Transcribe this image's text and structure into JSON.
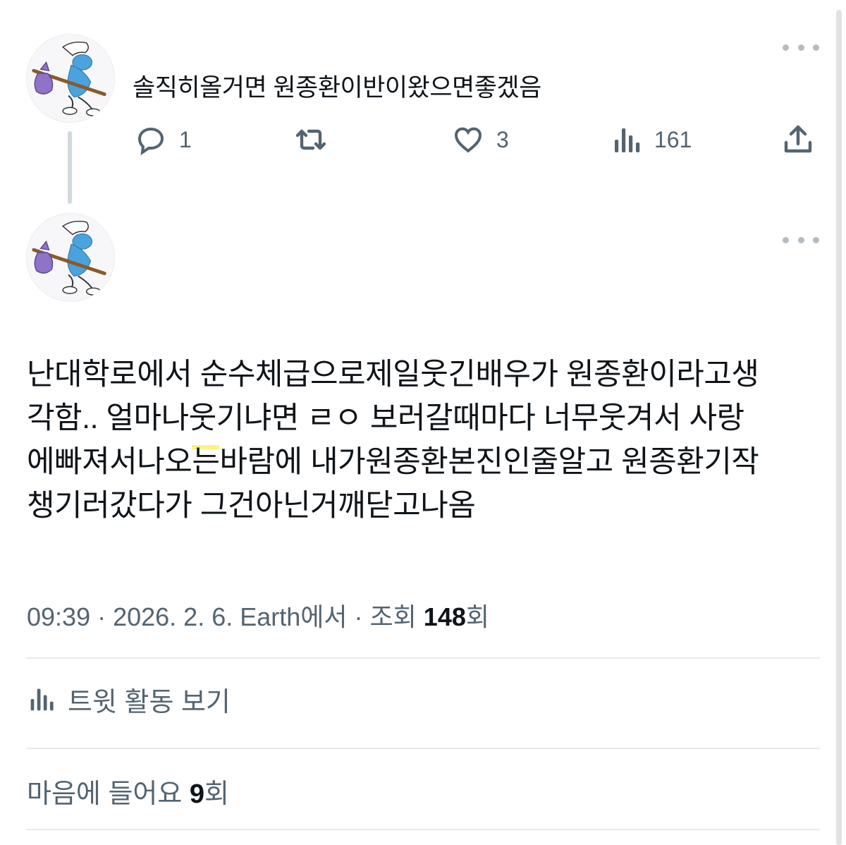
{
  "reply_tweet": {
    "avatar": "smurf-avatar",
    "text": "솔직히올거면 원종환이반이왔으면좋겠음",
    "actions": {
      "reply": {
        "icon": "reply-icon",
        "count": "1"
      },
      "retweet": {
        "icon": "retweet-icon",
        "count": ""
      },
      "like": {
        "icon": "heart-icon",
        "count": "3"
      },
      "views": {
        "icon": "views-icon",
        "count": "161"
      },
      "share": {
        "icon": "share-icon"
      }
    },
    "more_icon": "more-icon"
  },
  "main_tweet": {
    "avatar": "smurf-avatar",
    "more_icon": "more-icon",
    "text_lines": {
      "l1": "난대학로에서 순수체급으로제일웃긴배우가 원종환이라고생",
      "l2": "각함.. 얼마나웃기냐면 ㄹㅇ 보러갈때마다 너무웃겨서 사랑",
      "l3a": "에빠져서나오",
      "l3b": "는",
      "l3c": "바람에 내가원종환본진인줄알고 원종환기작",
      "l4": "챙기러갔다가 그건아닌거깨닫고나옴"
    },
    "meta": {
      "time": "09:39",
      "sep1": " · ",
      "date": "2026. 2. 6.",
      "source": "Earth에서",
      "sep2": " · ",
      "views_label": "조회 ",
      "views_count": "148",
      "views_suffix": "회"
    },
    "activity": {
      "icon": "views-icon",
      "label": "트윗 활동 보기"
    },
    "likes": {
      "label": "마음에 들어요 ",
      "count": "9",
      "suffix": "회"
    }
  },
  "colors": {
    "text_primary": "#0f1419",
    "text_secondary": "#536471",
    "divider": "#e7ebed",
    "thread_line": "#cfd9de",
    "highlight": "#fff27a"
  }
}
